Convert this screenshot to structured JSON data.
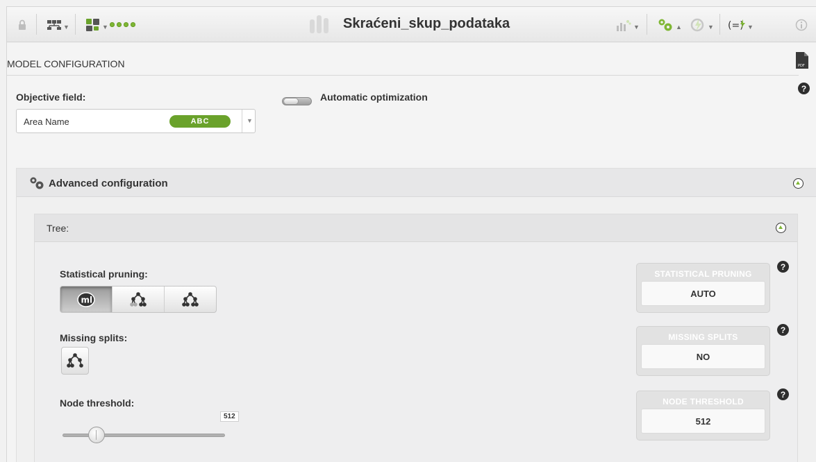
{
  "dataset": {
    "title": "Skraćeni_skup_podataka"
  },
  "toolbar": {
    "left_icons": [
      "lock-icon",
      "network-icon",
      "dataset-switch-icon",
      "status-dots-icon"
    ],
    "right_icons": [
      "chart-menu-icon",
      "configure-model-icon",
      "one-click-icon",
      "formula-icon",
      "info-icon"
    ],
    "accent_color": "#7fb734"
  },
  "model_config": {
    "title": "MODEL CONFIGURATION",
    "objective_label": "Objective field:",
    "objective_value": "Area Name",
    "objective_type": "ABC",
    "auto_opt_label": "Automatic optimization"
  },
  "advanced": {
    "title": "Advanced configuration",
    "tree": {
      "title": "Tree:",
      "pruning_label": "Statistical pruning:",
      "missing_label": "Missing splits:",
      "threshold_label": "Node threshold:",
      "threshold_value": "512",
      "threshold_fraction": 0.21
    }
  },
  "summary": [
    {
      "caption": "STATISTICAL PRUNING",
      "value": "AUTO"
    },
    {
      "caption": "MISSING SPLITS",
      "value": "NO"
    },
    {
      "caption": "NODE THRESHOLD",
      "value": "512"
    }
  ],
  "help_glyph": "?"
}
